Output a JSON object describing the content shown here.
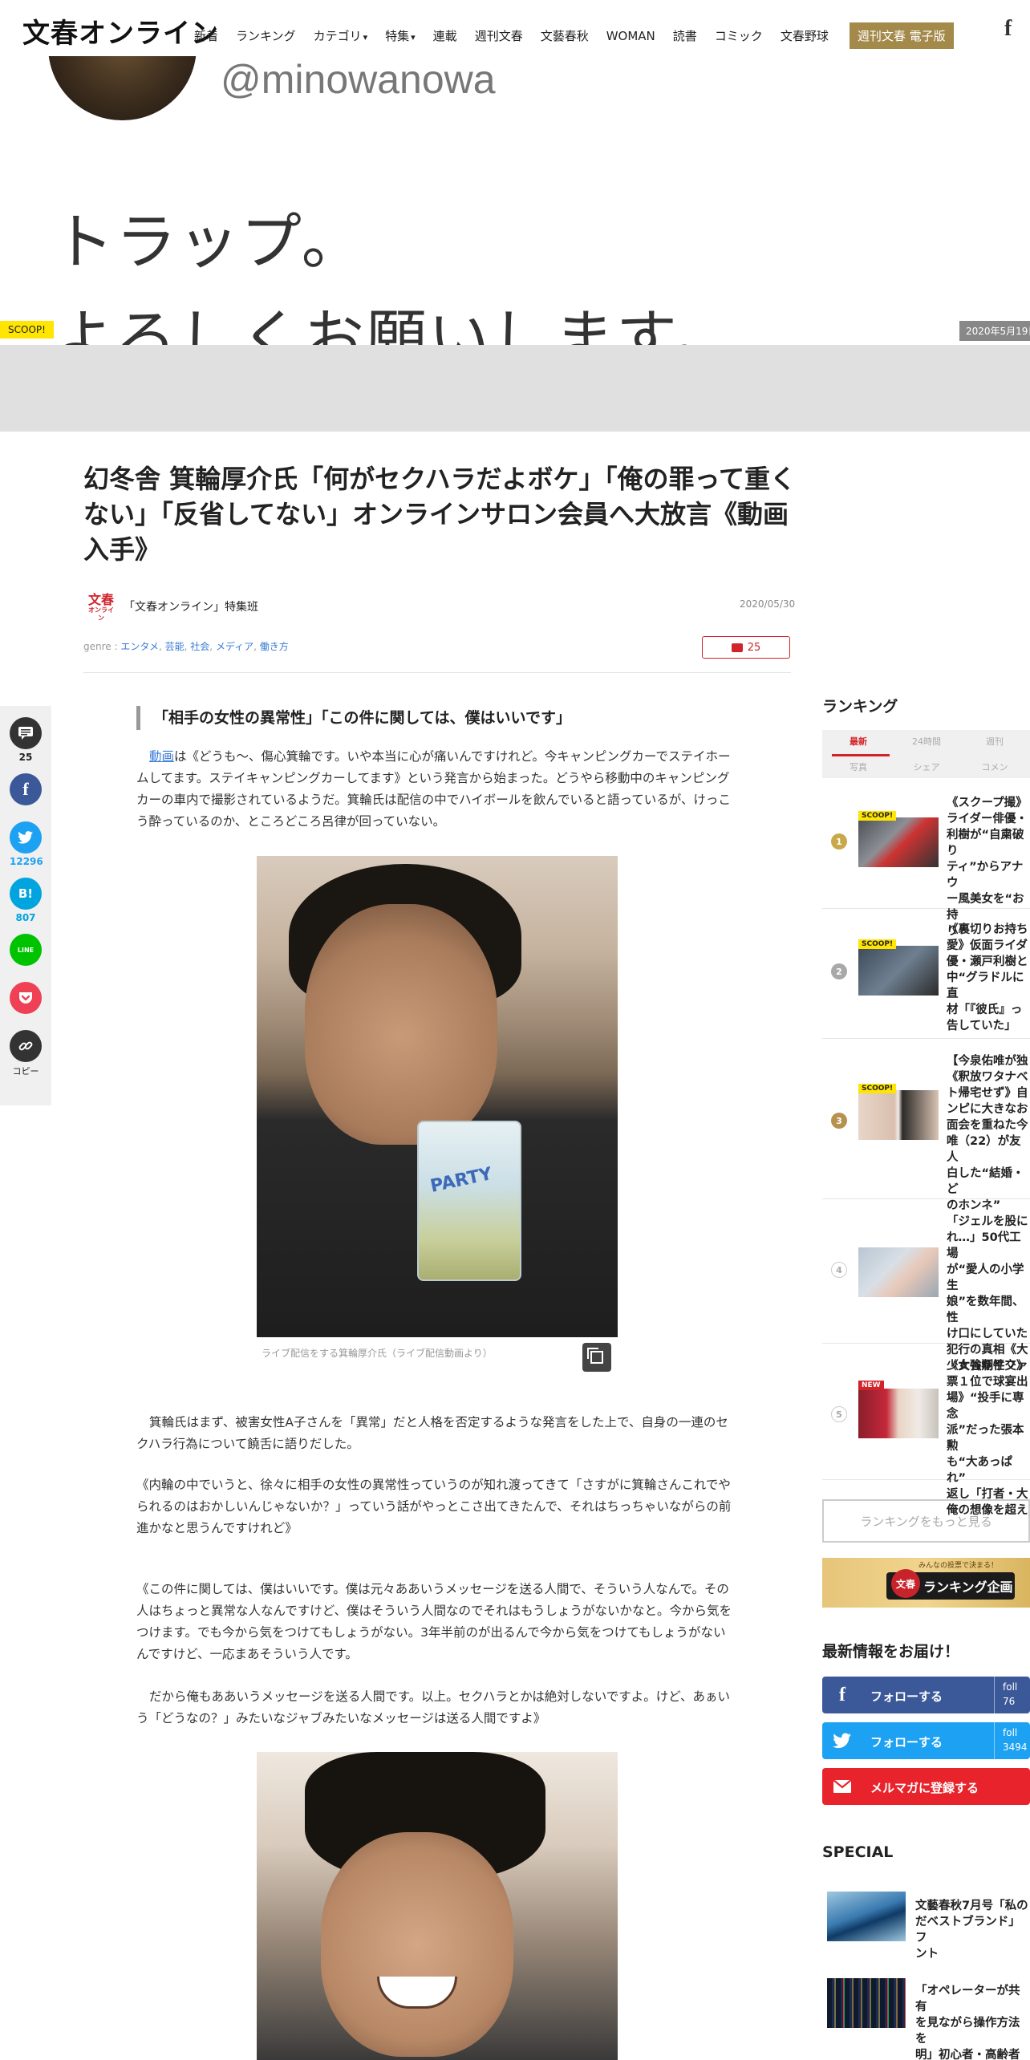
{
  "header": {
    "logo": "文春オンライン",
    "nav": [
      "新着",
      "ランキング",
      "カテゴリ",
      "特集",
      "連載",
      "週刊文春",
      "文藝春秋",
      "WOMAN",
      "読書",
      "コミック",
      "文春野球"
    ],
    "nav_button": "週刊文春 電子版",
    "facebook_glyph": "f"
  },
  "hero": {
    "handle": "@minowanowa",
    "line1": "トラップ。",
    "line2": "よろしくお願いします。",
    "scoop_tag": "SCOOP!",
    "date": "2020年5月19日"
  },
  "article": {
    "title": "幻冬舎 箕輪厚介氏「何がセクハラだよボケ」「俺の罪って重くない」「反省してない」オンラインサロン会員へ大放言《動画入手》",
    "author_logo_main": "文春",
    "author_logo_sub": "オンライン",
    "author": "「文春オンライン」特集班",
    "date": "2020/05/30",
    "genre_label": "genre : ",
    "genres": [
      "エンタメ",
      "芸能",
      "社会",
      "メディア",
      "働き方"
    ],
    "comment_count": "25",
    "subhead": "「相手の女性の異常性」「この件に関しては、僕はいいです」",
    "p1_link": "動画",
    "p1_rest": "は《どうも～、傷心箕輪です。いや本当に心が痛いんですけれど。今キャンピングカーでステイホームしてます。ステイキャンピングカーしてます》という発言から始まった。どうやら移動中のキャンピングカーの車内で撮影されているようだ。箕輪氏は配信の中でハイボールを飲んでいると語っているが、けっこう酔っているのか、ところどころ呂律が回っていない。",
    "cup_label": "PARTY",
    "caption": "ライブ配信をする箕輪厚介氏（ライブ配信動画より）",
    "p2": "箕輪氏はまず、被害女性A子さんを「異常」だと人格を否定するような発言をした上で、自身の一連のセクハラ行為について饒舌に語りだした。",
    "p3": "《内輪の中でいうと、徐々に相手の女性の異常性っていうのが知れ渡ってきて「さすがに箕輪さんこれでやられるのはおかしいんじゃないか？」っていう話がやっとこさ出てきたんで、それはちっちゃいながらの前進かなと思うんですけれど》",
    "p4": "《この件に関しては、僕はいいです。僕は元々ああいうメッセージを送る人間で、そういう人なんで。その人はちょっと異常な人なんですけど、僕はそういう人間なのでそれはもうしょうがないかなと。今から気をつけます。でも今から気をつけてもしょうがない。3年半前のが出るんで今から気をつけてもしょうがないんですけど、一応まあそういう人です。",
    "p5": "だから俺もああいうメッセージを送る人間です。以上。セクハラとかは絶対しないですよ。けど、あぁいう「どうなの？」みたいなジャブみたいなメッセージは送る人間ですよ》"
  },
  "share": {
    "comment_count": "25",
    "twitter_count": "12296",
    "hatena_glyph": "B!",
    "hatena_count": "807",
    "line_glyph": "LINE",
    "copy_label": "コピー",
    "icons": [
      "comment-icon",
      "facebook-icon",
      "twitter-icon",
      "hatena-icon",
      "line-icon",
      "pocket-icon",
      "link-icon"
    ]
  },
  "sidebar": {
    "ranking_heading": "ランキング",
    "tabs_row1": [
      "最新",
      "24時間",
      "週刊"
    ],
    "tabs_row2": [
      "写真",
      "シェア",
      "コメン"
    ],
    "ranking": [
      {
        "num": "1",
        "badge": "SCOOP!",
        "text": "《スクープ撮》\nライダー俳優・\n利樹が“自粛破り\nティ”からアナウ\nー風美女を“お持\nり”"
      },
      {
        "num": "2",
        "badge": "SCOOP!",
        "text": "《裏切りお持ち\n愛》仮面ライダ\n優・瀬戸利樹と\n中“グラドルに直\n材「『彼氏』っ\n告していた」"
      },
      {
        "num": "3",
        "badge": "SCOOP!",
        "text": "【今泉佑唯が独\n《釈放ワタナベ\nト帰宅せず》自\nンピに大きなお\n面会を重ねた今\n唯（22）が友人\n白した“結婚・ど\nのホンネ”"
      },
      {
        "num": "4",
        "badge": "",
        "text": "「ジェルを股に\nれ…」50代工場\nが“愛人の小学生\n娘”を数年間、性\nけ口にしていた\n犯行の真相《大\n少女強制性交》"
      },
      {
        "num": "5",
        "badge": "NEW",
        "text": "《大谷翔平ファ\n票１位で球宴出\n場》“投手に専念\n派”だった張本勲\nも“大あっぱれ”\n返し「打者・大\n俺の想像を超え"
      }
    ],
    "more_button": "ランキングをもっと見る",
    "banner_circle": "文春",
    "banner_top": "みんなの投票で決まる！",
    "banner_text": "ランキング企画",
    "news_heading": "最新情報をお届け！",
    "follow_fb": "フォローする",
    "follow_fb_count": "foll\n76",
    "follow_tw": "フォローする",
    "follow_tw_count": "foll\n3494",
    "follow_mail": "メルマガに登録する",
    "special_heading": "SPECIAL",
    "special": [
      {
        "text": "文藝春秋7月号「私の\nだベストブランド」フ\nント"
      },
      {
        "text": "「オペレーターが共有\nを見ながら操作方法を\n明」初心者・高齢者も\nの「外貨保有のために"
      }
    ]
  }
}
